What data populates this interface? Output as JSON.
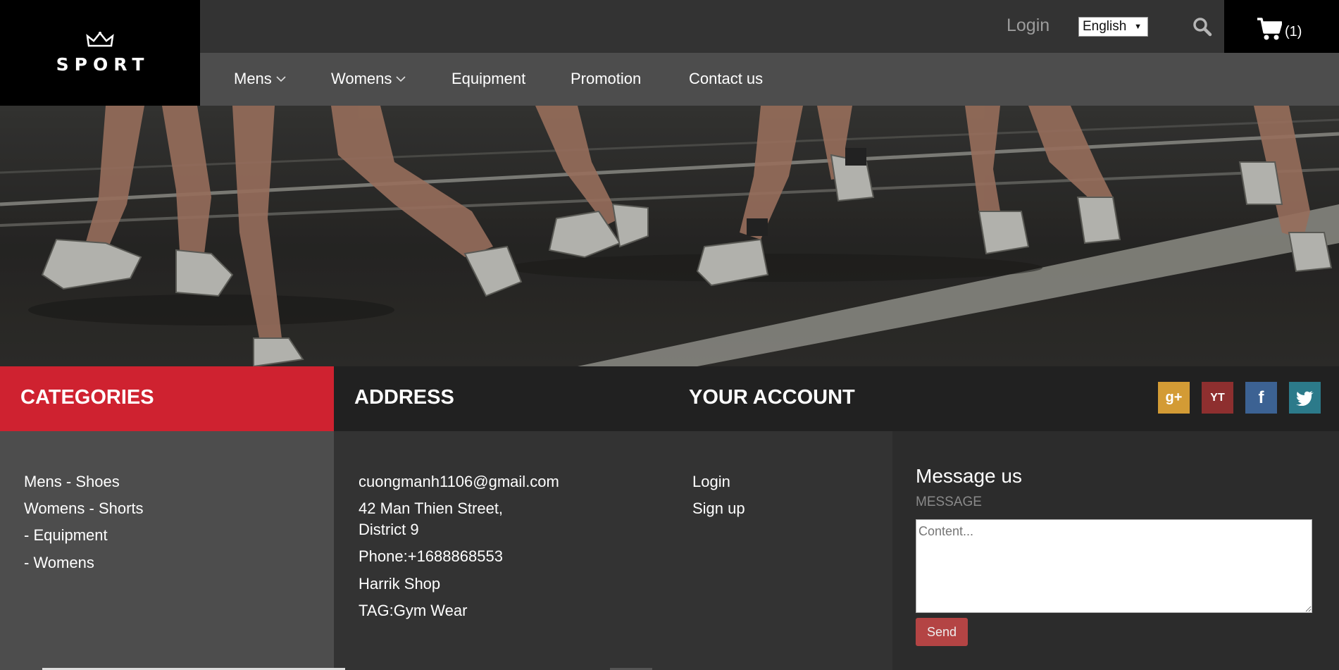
{
  "brand": {
    "name": "SPORT"
  },
  "topbar": {
    "login": "Login",
    "language": "English",
    "cart_count": "(1)"
  },
  "nav": {
    "items": [
      {
        "label": "Mens",
        "has_dropdown": true
      },
      {
        "label": "Womens",
        "has_dropdown": true
      },
      {
        "label": "Equipment",
        "has_dropdown": false
      },
      {
        "label": "Promotion",
        "has_dropdown": false
      },
      {
        "label": "Contact us",
        "has_dropdown": false
      }
    ]
  },
  "footer": {
    "categories": {
      "heading": "CATEGORIES",
      "items": [
        "Mens - Shoes",
        "Womens - Shorts",
        "- Equipment",
        "- Womens"
      ]
    },
    "address": {
      "heading": "ADDRESS",
      "email": "cuongmanh1106@gmail.com",
      "street_line1": "42 Man Thien Street,",
      "street_line2": "District 9",
      "phone": "Phone:+1688868553",
      "shop": "Harrik Shop",
      "tag": "TAG:Gym Wear"
    },
    "account": {
      "heading": "YOUR ACCOUNT",
      "items": [
        "Login",
        "Sign up"
      ]
    },
    "social": [
      {
        "icon": "google-plus-icon",
        "glyph": "g+",
        "color": "#d39b35"
      },
      {
        "icon": "youtube-icon",
        "glyph": "YT",
        "color": "#8e2f2f"
      },
      {
        "icon": "facebook-icon",
        "glyph": "f",
        "color": "#3c6293"
      },
      {
        "icon": "twitter-icon",
        "glyph": "t",
        "color": "#2c7a8a"
      }
    ],
    "message": {
      "title": "Message us",
      "label": "MESSAGE",
      "placeholder": "Content...",
      "send_label": "Send"
    }
  },
  "colors": {
    "accent_red": "#cf2230",
    "nav_bg": "#4d4d4d",
    "topbar_bg": "#333333"
  }
}
